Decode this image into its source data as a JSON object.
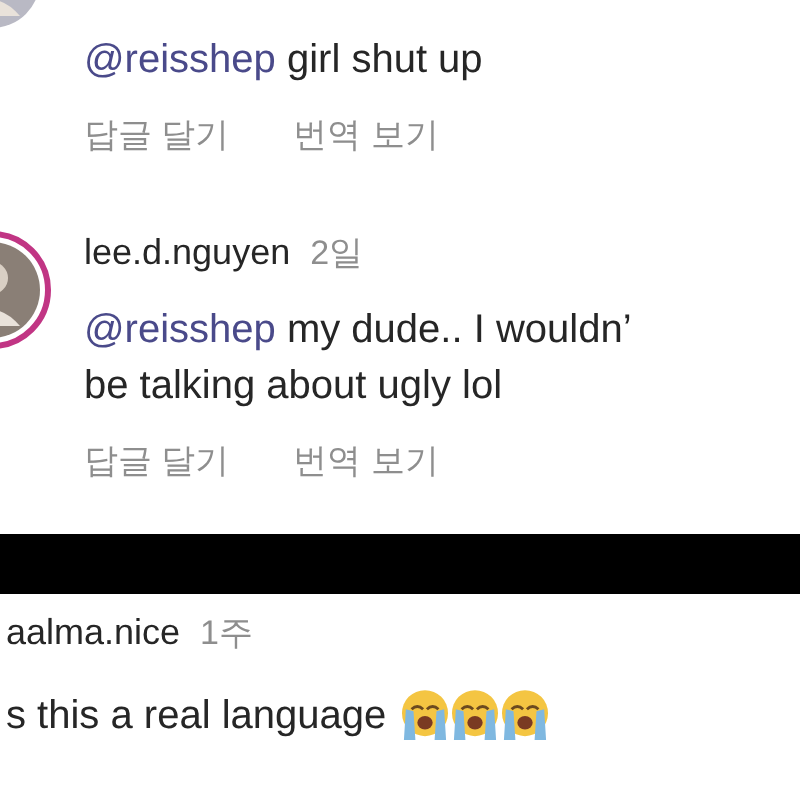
{
  "comments": [
    {
      "mention": "@reisshep",
      "lines": [
        "girl shut up"
      ],
      "actions": [
        "답글 달기",
        "번역 보기"
      ]
    },
    {
      "username": "lee.d.nguyen",
      "time": "2일",
      "mention": "@reisshep",
      "lines": [
        "my dude.. I wouldn’",
        "be talking about ugly lol"
      ],
      "actions": [
        "답글 달기",
        "번역 보기"
      ]
    }
  ],
  "next_comment": {
    "username": "aalma.nice",
    "time": "1주",
    "text": "s this a real language",
    "emojis": [
      {
        "kind": "crying"
      },
      {
        "kind": "crying"
      },
      {
        "kind": "crying"
      }
    ]
  }
}
